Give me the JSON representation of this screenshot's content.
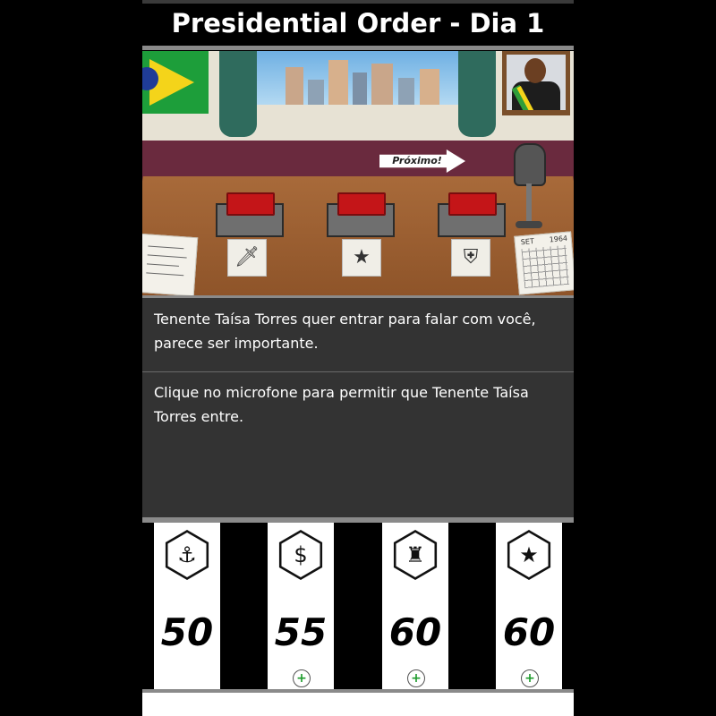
{
  "header": {
    "title": "Presidential Order - Dia 1"
  },
  "scene": {
    "next_label": "Próximo!",
    "calendar_label": "SET",
    "calendar_year": "1964",
    "cards": [
      "dagger-icon",
      "star-icon",
      "shield-icon"
    ]
  },
  "messages": {
    "event": "Tenente Taísa Torres quer entrar para falar com você, parece ser importante.",
    "instruction": "Clique no microfone para permitir que Tenente Taísa Torres entre."
  },
  "stats": [
    {
      "icon": "military-icon",
      "value": "50",
      "has_plus": false
    },
    {
      "icon": "economy-icon",
      "value": "55",
      "has_plus": true
    },
    {
      "icon": "industry-icon",
      "value": "60",
      "has_plus": true
    },
    {
      "icon": "eagle-star-icon",
      "value": "60",
      "has_plus": true
    }
  ],
  "colors": {
    "accent_green": "#1e9b2c",
    "button_red": "#c41518",
    "panel_bg": "#333333"
  }
}
